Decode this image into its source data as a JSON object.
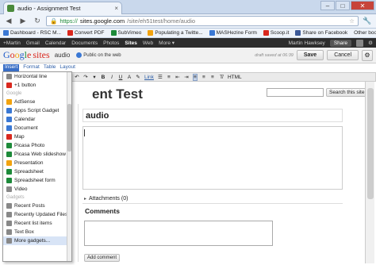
{
  "browser": {
    "tab_title": "audio - Assignment Test",
    "url_scheme": "https://",
    "url_host": "sites.google.com",
    "url_path": "/site/eh51test/home/audio",
    "bookmarks": [
      {
        "label": "Dashboard - RSC M...",
        "color": "#3a78d4"
      },
      {
        "label": "Convert PDF",
        "color": "#d9281e"
      },
      {
        "label": "SubVimeo",
        "color": "#1d8a3a"
      },
      {
        "label": "Populating a Twitte...",
        "color": "#f2a30f"
      },
      {
        "label": "MASHezine Form",
        "color": "#3a78d4"
      },
      {
        "label": "Scoop.it",
        "color": "#d9281e"
      },
      {
        "label": "Share on Facebook",
        "color": "#3b5998"
      }
    ],
    "other_bookmarks": "Other bookmarks"
  },
  "gbar": {
    "items": [
      "+Martin",
      "Gmail",
      "Calendar",
      "Documents",
      "Photos",
      "Sites",
      "Web",
      "More ▾"
    ],
    "active": "Sites",
    "user": "Martin Hawksey",
    "share": "Share"
  },
  "sites_header": {
    "logo_letters": [
      "G",
      "o",
      "o",
      "g",
      "l",
      "e"
    ],
    "logo_sites": "sites",
    "page_name": "audio",
    "public_label": "Public on the web",
    "draft_status": "draft saved at 06:39",
    "save_label": "Save",
    "cancel_label": "Cancel"
  },
  "editor_menu": [
    "Insert",
    "Format",
    "Table",
    "Layout"
  ],
  "toolbar": {
    "undo": "↶",
    "redo": "↷",
    "font": "▾",
    "bold": "B",
    "italic": "I",
    "underline": "U",
    "color": "A",
    "highlight": "✎",
    "link": "Link",
    "ol": "☰",
    "ul": "≡",
    "indent_out": "⇤",
    "indent_in": "⇥",
    "align_left": "≡",
    "align_center": "≡",
    "align_right": "≡",
    "clear": "T̸",
    "html": "HTML"
  },
  "insert_menu": {
    "top_items": [
      {
        "label": "Horizontal line",
        "color": "#888"
      },
      {
        "label": "+1 button",
        "color": "#d9281e"
      }
    ],
    "google_section": "Google",
    "google_items": [
      {
        "label": "AdSense",
        "color": "#f2a30f"
      },
      {
        "label": "Apps Script Gadget",
        "color": "#3a78d4"
      },
      {
        "label": "Calendar",
        "color": "#3a78d4"
      },
      {
        "label": "Document",
        "color": "#3a78d4"
      },
      {
        "label": "Map",
        "color": "#d9281e"
      },
      {
        "label": "Picasa Photo",
        "color": "#1d8a3a"
      },
      {
        "label": "Picasa Web slideshow",
        "color": "#1d8a3a"
      },
      {
        "label": "Presentation",
        "color": "#f2a30f"
      },
      {
        "label": "Spreadsheet",
        "color": "#1d8a3a"
      },
      {
        "label": "Spreadsheet form",
        "color": "#1d8a3a"
      },
      {
        "label": "Video",
        "color": "#888"
      }
    ],
    "gadgets_section": "Gadgets",
    "gadget_items": [
      {
        "label": "Recent Posts",
        "color": "#888"
      },
      {
        "label": "Recently Updated Files",
        "color": "#888"
      },
      {
        "label": "Recent list items",
        "color": "#888"
      },
      {
        "label": "Text Box",
        "color": "#888"
      },
      {
        "label": "More gadgets...",
        "color": "#888"
      }
    ]
  },
  "page": {
    "title": "ent Test",
    "search_button": "Search this site",
    "heading": "audio",
    "attachments": "Attachments (0)",
    "comments": "Comments",
    "add_comment": "Add comment"
  }
}
